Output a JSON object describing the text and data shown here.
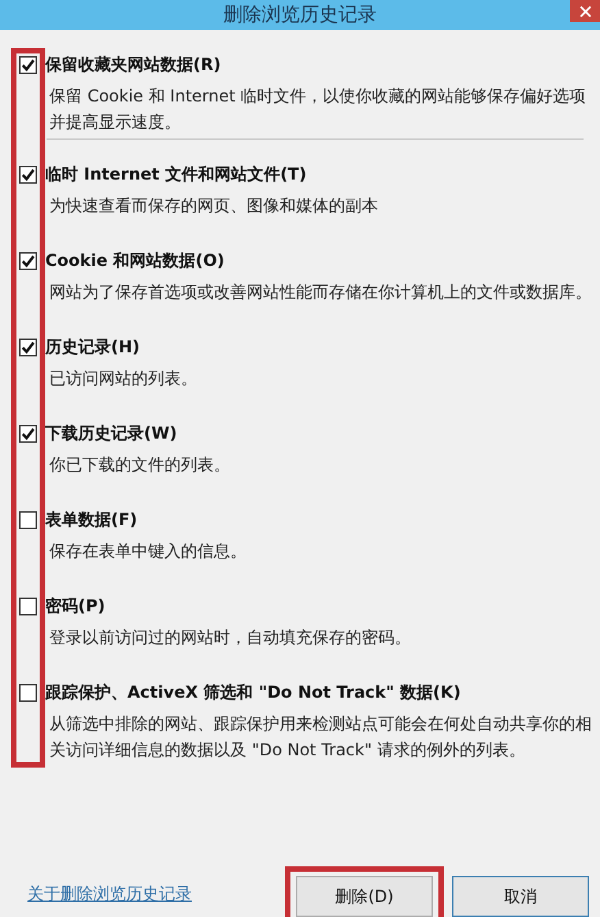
{
  "window": {
    "title": "删除浏览历史记录"
  },
  "preserve_favorites": {
    "label": "保留收藏夹网站数据(R)",
    "description": "保留 Cookie 和 Internet 临时文件，以使你收藏的网站能够保存偏好选项并提高显示速度。",
    "checked": true
  },
  "options": [
    {
      "label": "临时 Internet 文件和网站文件(T)",
      "description": "为快速查看而保存的网页、图像和媒体的副本",
      "checked": true
    },
    {
      "label": "Cookie 和网站数据(O)",
      "description": "网站为了保存首选项或改善网站性能而存储在你计算机上的文件或数据库。",
      "checked": true
    },
    {
      "label": "历史记录(H)",
      "description": "已访问网站的列表。",
      "checked": true
    },
    {
      "label": "下载历史记录(W)",
      "description": "你已下载的文件的列表。",
      "checked": true
    },
    {
      "label": "表单数据(F)",
      "description": "保存在表单中键入的信息。",
      "checked": false
    },
    {
      "label": "密码(P)",
      "description": "登录以前访问过的网站时，自动填充保存的密码。",
      "checked": false
    },
    {
      "label": "跟踪保护、ActiveX 筛选和 \"Do Not Track\" 数据(K)",
      "description": "从筛选中排除的网站、跟踪保护用来检测站点可能会在何处自动共享你的相关访问详细信息的数据以及 \"Do Not Track\" 请求的例外的列表。",
      "checked": false
    }
  ],
  "footer": {
    "link": "关于删除浏览历史记录",
    "buttons": [
      {
        "label": "删除(D)"
      },
      {
        "label": "取消"
      }
    ]
  }
}
